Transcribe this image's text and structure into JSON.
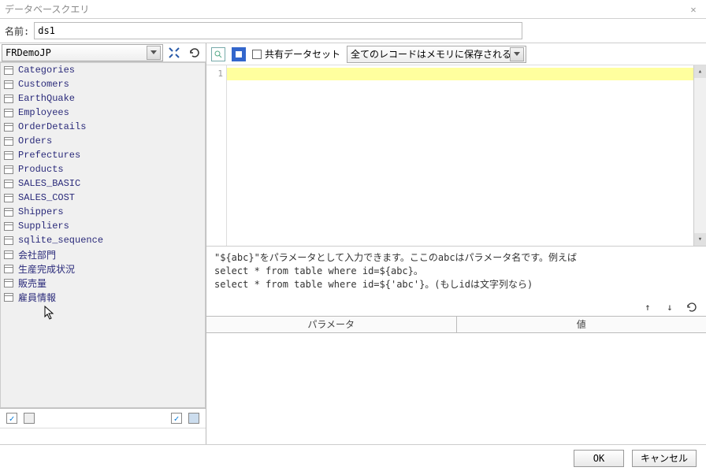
{
  "window": {
    "title": "データベースクエリ"
  },
  "name_row": {
    "label": "名前:",
    "value": "ds1"
  },
  "datasource": {
    "selected": "FRDemoJP"
  },
  "tables": [
    "Categories",
    "Customers",
    "EarthQuake",
    "Employees",
    "OrderDetails",
    "Orders",
    "Prefectures",
    "Products",
    "SALES_BASIC",
    "SALES_COST",
    "Shippers",
    "Suppliers",
    "sqlite_sequence",
    "会社部門",
    "生産完成状況",
    "販売量",
    "雇員情報"
  ],
  "right_toolbar": {
    "shared_label": "共有データセット",
    "memory_option": "全てのレコードはメモリに保存される"
  },
  "editor": {
    "line_number": "1"
  },
  "hint": {
    "line1_a": "\"${abc}\"をパラメータとして入力できます。ここのabcはパラメータ名です。例えば",
    "line2": "select * from table where id=${abc}。",
    "line3": "select * from table where id=${'abc'}。(もしidは文字列なら)"
  },
  "param_table": {
    "col_param": "パラメータ",
    "col_value": "値"
  },
  "footer": {
    "ok": "OK",
    "cancel": "キャンセル"
  }
}
